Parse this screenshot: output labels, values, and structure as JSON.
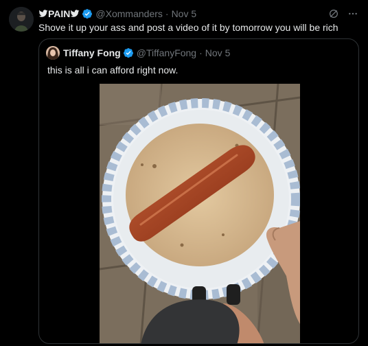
{
  "tweet": {
    "author_name": "PAIN",
    "handle": "@Xommanders",
    "separator": "·",
    "date": "Nov 5",
    "text": "Shove it up your ass and post a video of it by tomorrow you will be rich"
  },
  "quoted_tweet": {
    "author_name": "Tiffany Fong",
    "handle": "@TiffanyFong",
    "separator": "·",
    "date": "Nov 5",
    "text": "this is all i can afford right now.",
    "media": "photo-hotdog-on-tortilla-on-plate"
  },
  "icons": {
    "verified": "verified-badge-icon",
    "grok": "grok-icon",
    "more": "more-icon"
  },
  "colors": {
    "background": "#000000",
    "text": "#e7e9ea",
    "muted": "#71767b",
    "verified": "#1d9bf0",
    "border": "#2f3336"
  }
}
